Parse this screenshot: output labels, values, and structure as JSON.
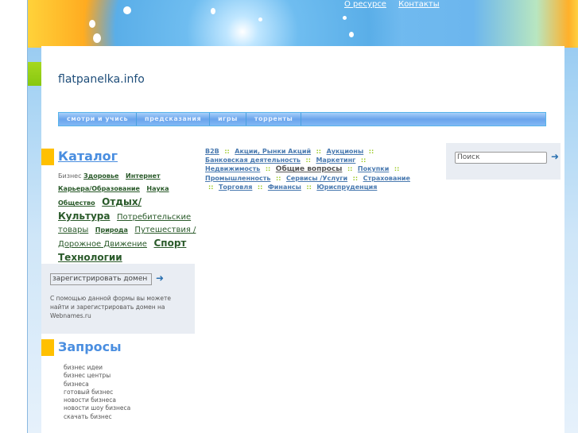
{
  "header": {
    "links": [
      "О ресурсе",
      "Контакты"
    ]
  },
  "site_title": "flatpanelka.info",
  "menu": [
    "смотри и учись",
    "предсказания",
    "игры",
    "торренты"
  ],
  "catalog": {
    "title": "Каталог",
    "label": "Бизнес",
    "links": [
      {
        "t": "Здоровье",
        "c": ""
      },
      {
        "t": "Интернет",
        "c": ""
      },
      {
        "t": "Карьера/Образование",
        "c": ""
      },
      {
        "t": "Наука",
        "c": ""
      },
      {
        "t": "Общество",
        "c": ""
      },
      {
        "t": "Отдых/Культура",
        "c": "l"
      },
      {
        "t": "Потребительские товары",
        "c": "m"
      },
      {
        "t": "Природа",
        "c": ""
      },
      {
        "t": "Путешествия / Дорожное Движение",
        "c": "m"
      },
      {
        "t": "Спорт",
        "c": "l"
      },
      {
        "t": "Технологии",
        "c": "l"
      }
    ]
  },
  "register": {
    "placeholder": "зарегистрировать домен",
    "note": "С помощью данной формы вы можете найти и зарегистрировать домен на Webnames.ru"
  },
  "queries": {
    "title": "Запросы",
    "items": [
      "бизнес идеи",
      "бизнес центры",
      "бизнеса",
      "готовый бизнес",
      "новости бизнеса",
      "новости шоу бизнеса",
      "скачать бизнес"
    ]
  },
  "categories": {
    "items": [
      "B2B",
      "Акции, Рынки Акций",
      "Аукционы",
      "Банковская деятельность",
      "Маркетинг",
      "Недвижимость",
      "Общие вопросы",
      "Покупки",
      "Промышленность",
      "Сервисы /Услуги",
      "Страхование",
      "Торговля",
      "Финансы",
      "Юриспруденция"
    ],
    "separator": "::"
  },
  "search": {
    "placeholder": "Поиск"
  },
  "icons": [
    "home-icon",
    "mail-icon",
    "sitemap-icon"
  ]
}
